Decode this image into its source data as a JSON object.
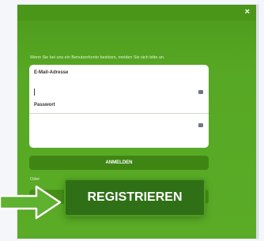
{
  "dialog": {
    "close_label": "×",
    "prompt": "Wenn Sie bei uns ein Benutzerkonto besitzen, melden Sie sich bitte an.",
    "email_label": "E-Mail-Adresse",
    "email_value": "",
    "password_label": "Passwort",
    "password_value": "",
    "login_label": "ANMELDEN",
    "or_label": "Oder",
    "register_label": "REGISTRIEREN"
  },
  "colors": {
    "panel_green": "#57a824",
    "button_dark_green": "#3f8514",
    "register_green": "#2f7016",
    "arrow_fill": "#5fb130"
  },
  "icons": [
    "close-icon",
    "key-icon",
    "arrow-icon"
  ]
}
